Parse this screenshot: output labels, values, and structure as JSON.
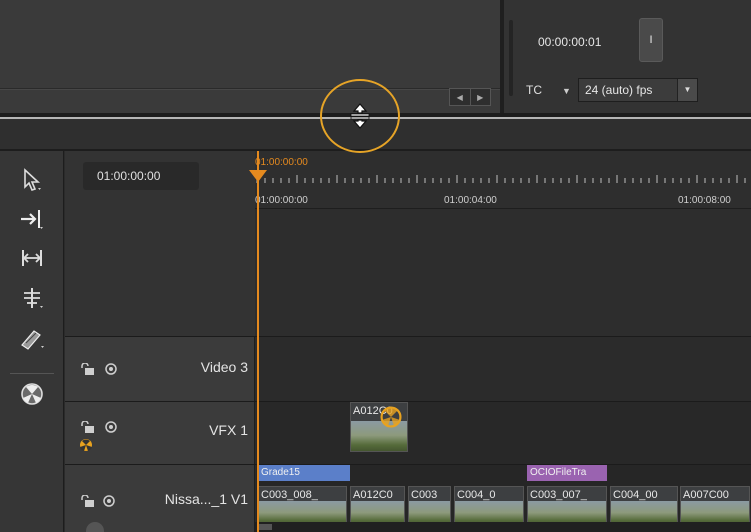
{
  "monitor": {
    "timecode": "00:00:00:01",
    "marker_button": "I",
    "tc_label": "TC",
    "fps": "24 (auto) fps"
  },
  "timeline": {
    "current_timecode": "01:00:00:00",
    "ruler": {
      "playhead_label": "01:00:00:00",
      "ticks": [
        "01:00:00:00",
        "01:00:04:00",
        "01:00:08:00"
      ]
    },
    "tracks": [
      {
        "name": "Video 3"
      },
      {
        "name": "VFX 1",
        "clips": [
          {
            "label": "A012C0"
          }
        ]
      },
      {
        "name": "Nissa..._1 V1",
        "grades": [
          {
            "label": "Grade15",
            "color": "#5b7fc9"
          },
          {
            "label": "OCIOFileTra",
            "color": "#9a63b0"
          }
        ],
        "clips": [
          {
            "label": "C003_008_"
          },
          {
            "label": "A012C0"
          },
          {
            "label": "C003"
          },
          {
            "label": "C004_0"
          },
          {
            "label": "C003_007_"
          },
          {
            "label": "C004_00"
          },
          {
            "label": "A007C00"
          }
        ]
      }
    ]
  },
  "colors": {
    "accent": "#e6a427",
    "playhead": "#e58a1f"
  },
  "icons": {
    "tools": [
      "pointer-icon",
      "insert-icon",
      "fit-icon",
      "ripple-icon",
      "razor-icon",
      "globe-icon"
    ]
  }
}
